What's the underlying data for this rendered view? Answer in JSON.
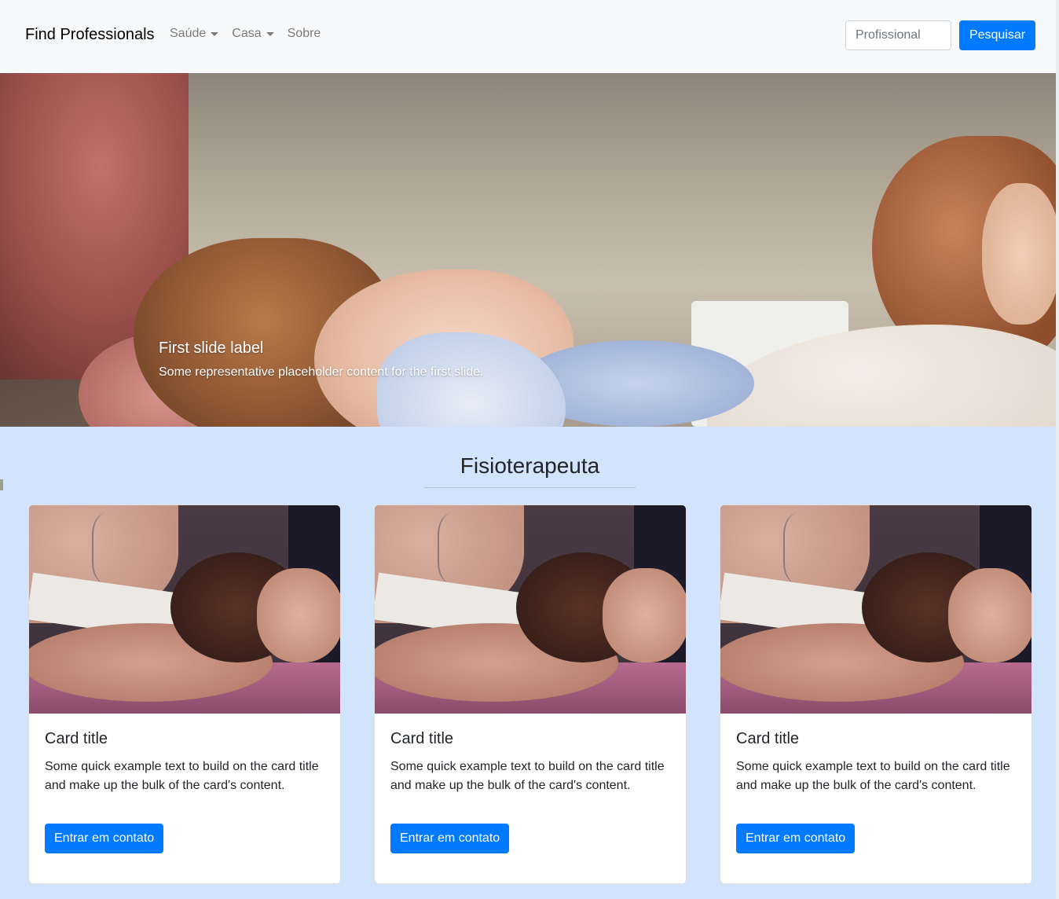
{
  "navbar": {
    "brand": "Find Professionals",
    "links": [
      {
        "label": "Saúde",
        "dropdown": true
      },
      {
        "label": "Casa",
        "dropdown": true
      },
      {
        "label": "Sobre",
        "dropdown": false
      }
    ],
    "search": {
      "placeholder": "Profissional",
      "value": ""
    },
    "search_button": "Pesquisar"
  },
  "carousel": {
    "caption_title": "First slide label",
    "caption_text": "Some representative placeholder content for the first slide."
  },
  "section": {
    "title": "Fisioterapeuta"
  },
  "cards": [
    {
      "title": "Card title",
      "text": "Some quick example text to build on the card title and make up the bulk of the card's content.",
      "button": "Entrar em contato"
    },
    {
      "title": "Card title",
      "text": "Some quick example text to build on the card title and make up the bulk of the card's content.",
      "button": "Entrar em contato"
    },
    {
      "title": "Card title",
      "text": "Some quick example text to build on the card title and make up the bulk of the card's content.",
      "button": "Entrar em contato"
    }
  ],
  "colors": {
    "primary": "#007bff",
    "page_background": "#d2e4fb",
    "navbar_background": "#f8f9fa"
  }
}
